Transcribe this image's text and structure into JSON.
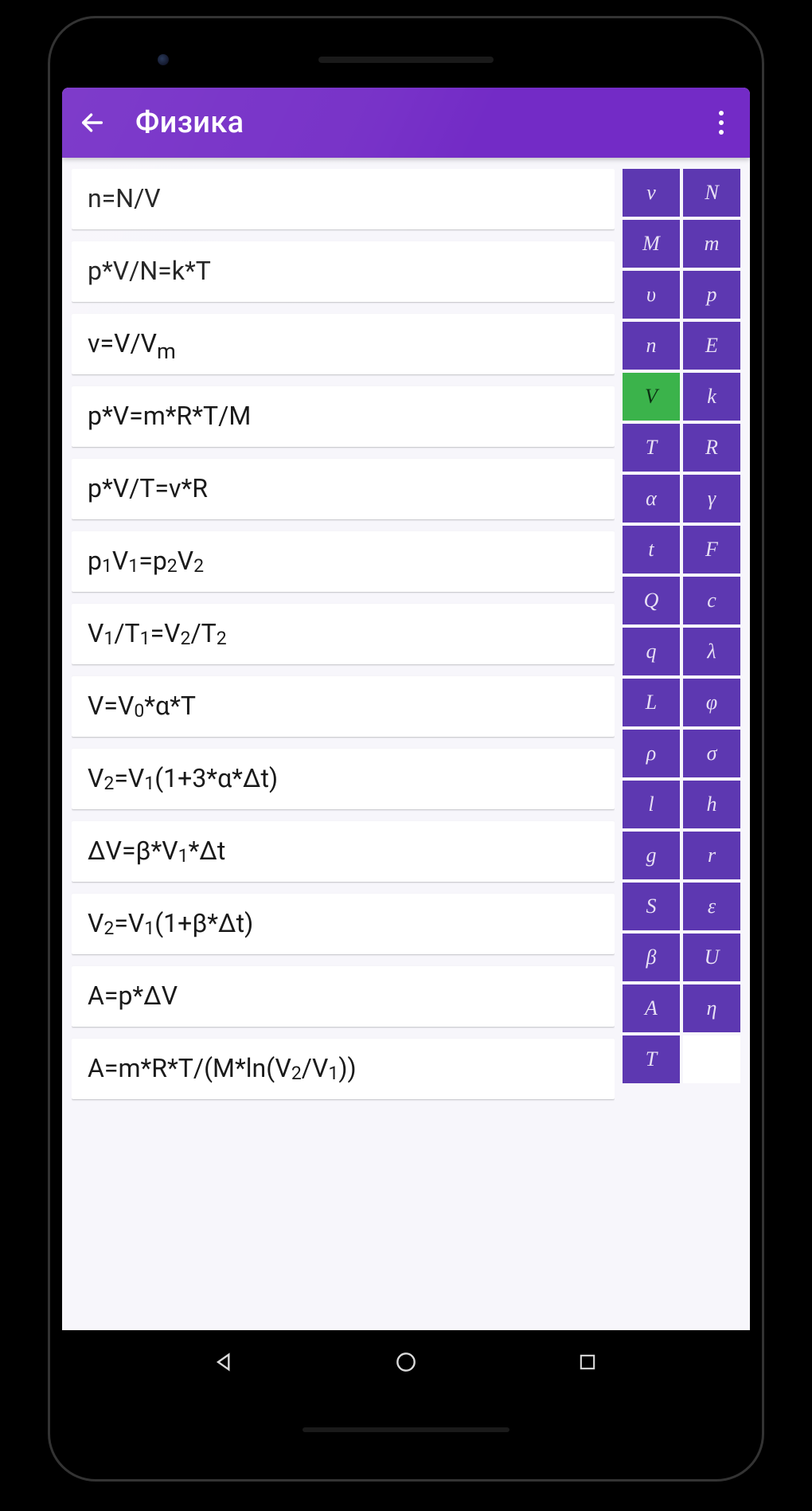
{
  "appbar": {
    "title": "Физика"
  },
  "formulas": [
    {
      "html": "n=N/V"
    },
    {
      "html": "p*V/N=k*T"
    },
    {
      "html": "ν=V/V<span class='sub-m'>m</span>"
    },
    {
      "html": "p*V=m*R*T/M"
    },
    {
      "html": "p*V/T=ν*R"
    },
    {
      "html": "p<span class='sub'>1</span>V<span class='sub'>1</span>=p<span class='sub'>2</span>V<span class='sub'>2</span>"
    },
    {
      "html": "V<span class='sub'>1</span>/T<span class='sub'>1</span>=V<span class='sub'>2</span>/T<span class='sub'>2</span>"
    },
    {
      "html": "V=V<span class='sub'>0</span>*α*T"
    },
    {
      "html": "V<span class='sub'>2</span>=V<span class='sub'>1</span>(1+3*α*Δt)"
    },
    {
      "html": "ΔV=β*V<span class='sub'>1</span>*Δt"
    },
    {
      "html": "V<span class='sub'>2</span>=V<span class='sub'>1</span>(1+β*Δt)"
    },
    {
      "html": "A=p*ΔV"
    },
    {
      "html": "A=m*R*T/(M*ln(V<span class='sub'>2</span>/V<span class='sub'>1</span>))"
    }
  ],
  "vars": [
    {
      "label": "v"
    },
    {
      "label": "N"
    },
    {
      "label": "M"
    },
    {
      "label": "m"
    },
    {
      "label": "υ"
    },
    {
      "label": "p"
    },
    {
      "label": "n"
    },
    {
      "label": "E"
    },
    {
      "label": "V",
      "selected": true
    },
    {
      "label": "k"
    },
    {
      "label": "T"
    },
    {
      "label": "R"
    },
    {
      "label": "α"
    },
    {
      "label": "γ"
    },
    {
      "label": "t"
    },
    {
      "label": "F"
    },
    {
      "label": "Q"
    },
    {
      "label": "c"
    },
    {
      "label": "q"
    },
    {
      "label": "λ"
    },
    {
      "label": "L"
    },
    {
      "label": "φ"
    },
    {
      "label": "ρ"
    },
    {
      "label": "σ"
    },
    {
      "label": "l"
    },
    {
      "label": "h"
    },
    {
      "label": "g"
    },
    {
      "label": "r"
    },
    {
      "label": "S"
    },
    {
      "label": "ε"
    },
    {
      "label": "β"
    },
    {
      "label": "U"
    },
    {
      "label": "A"
    },
    {
      "label": "η"
    },
    {
      "label": "T"
    },
    {
      "label": "",
      "blank": true
    }
  ]
}
